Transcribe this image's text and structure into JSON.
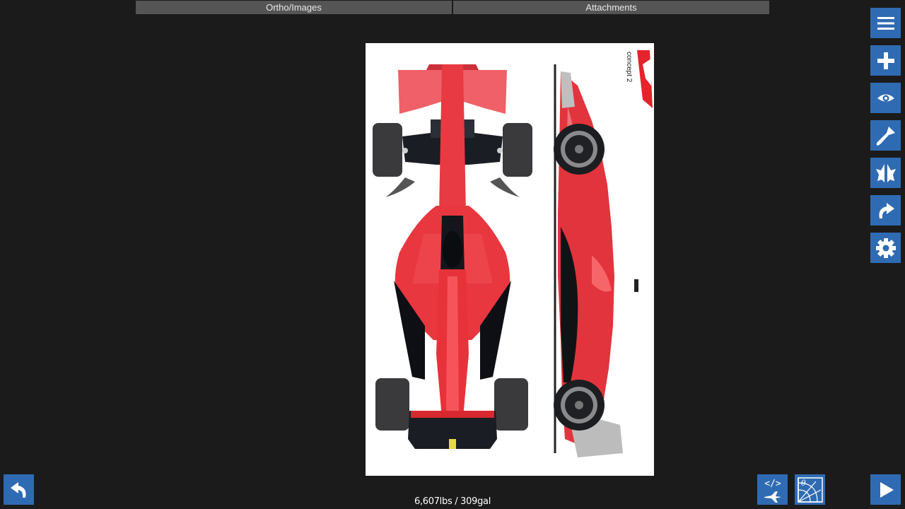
{
  "tabs": [
    {
      "label": "Ortho/Images"
    },
    {
      "label": "Attachments"
    }
  ],
  "image": {
    "logo_text": "concept 2"
  },
  "toolbar": {
    "items": [
      {
        "name": "menu-icon"
      },
      {
        "name": "add-icon"
      },
      {
        "name": "eye-icon"
      },
      {
        "name": "paint-brush-icon"
      },
      {
        "name": "symmetry-icon"
      },
      {
        "name": "redo-icon"
      },
      {
        "name": "gear-icon"
      }
    ]
  },
  "bottom": {
    "weight": "6,607lbs / 309gal"
  },
  "colors": {
    "accent": "#2f6bb3",
    "background": "#1b1b1b",
    "tab": "#555555",
    "car_red": "#e8323a"
  }
}
